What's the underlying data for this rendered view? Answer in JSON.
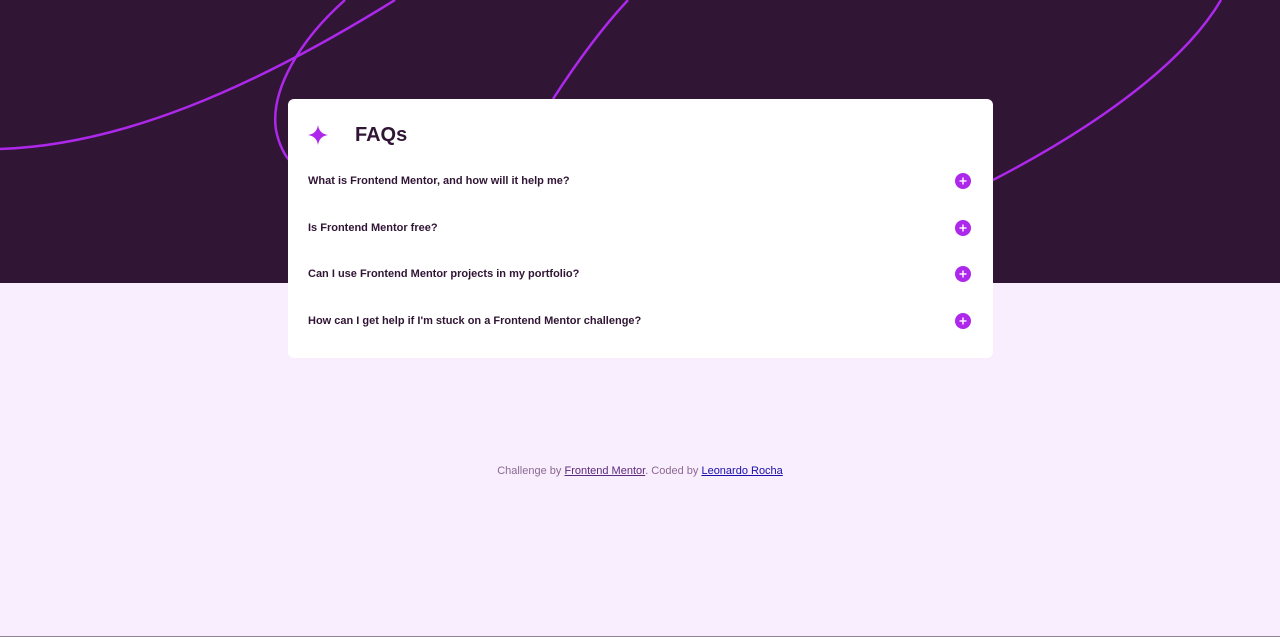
{
  "colors": {
    "hero_bg": "#301534",
    "page_bg": "#f8eefe",
    "accent": "#ad28eb",
    "text_dark": "#301534",
    "footer_text": "#8c6991"
  },
  "card": {
    "title": "FAQs",
    "title_icon": "star-icon",
    "items": [
      {
        "question": "What is Frontend Mentor, and how will it help me?",
        "icon": "plus-icon"
      },
      {
        "question": "Is Frontend Mentor free?",
        "icon": "plus-icon"
      },
      {
        "question": "Can I use Frontend Mentor projects in my portfolio?",
        "icon": "plus-icon"
      },
      {
        "question": "How can I get help if I'm stuck on a Frontend Mentor challenge?",
        "icon": "plus-icon"
      }
    ]
  },
  "footer": {
    "prefix": "Challenge by ",
    "link1": "Frontend Mentor",
    "middle": ". Coded by ",
    "link2": "Leonardo Rocha"
  }
}
